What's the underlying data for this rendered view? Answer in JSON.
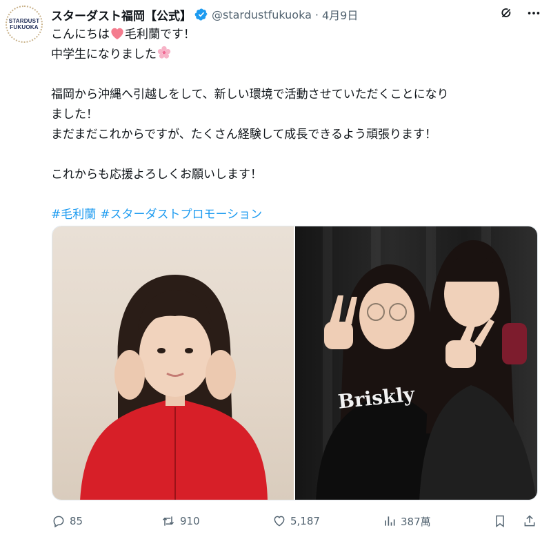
{
  "account": {
    "avatar_lines": [
      "STARDUST",
      "FUKUOKA"
    ],
    "display_name": "スターダスト福岡【公式】",
    "handle": "@stardustfukuoka",
    "separator": "·",
    "date": "4月9日"
  },
  "post": {
    "line1_a": "こんにちは",
    "line1_b": "毛利蘭です！",
    "line2": "中学生になりました",
    "line3": "福岡から沖縄へ引越しをして、新しい環境で活動させていただくことになり",
    "line4": "ました！",
    "line5": "まだまだこれからですが、たくさん経験して成長できるよう頑張ります！",
    "line6": "これからも応援よろしくお願いします！",
    "hashtags": [
      "#毛利蘭",
      "#スターダストプロモーション"
    ]
  },
  "media": {
    "photo_right_shirt_text": "Briskly"
  },
  "stats": {
    "replies": "85",
    "reposts": "910",
    "likes": "5,187",
    "views": "387萬"
  },
  "icons": {
    "verified": "verified-badge-icon",
    "grok": "grok-icon",
    "more": "more-icon",
    "reply": "reply-icon",
    "repost": "repost-icon",
    "like": "like-icon",
    "views": "views-icon",
    "bookmark": "bookmark-icon",
    "share": "share-icon"
  },
  "colors": {
    "link": "#1d9bf0",
    "muted": "#536471",
    "heart_emoji": "#f47c8e",
    "verified": "#1d9bf0"
  }
}
